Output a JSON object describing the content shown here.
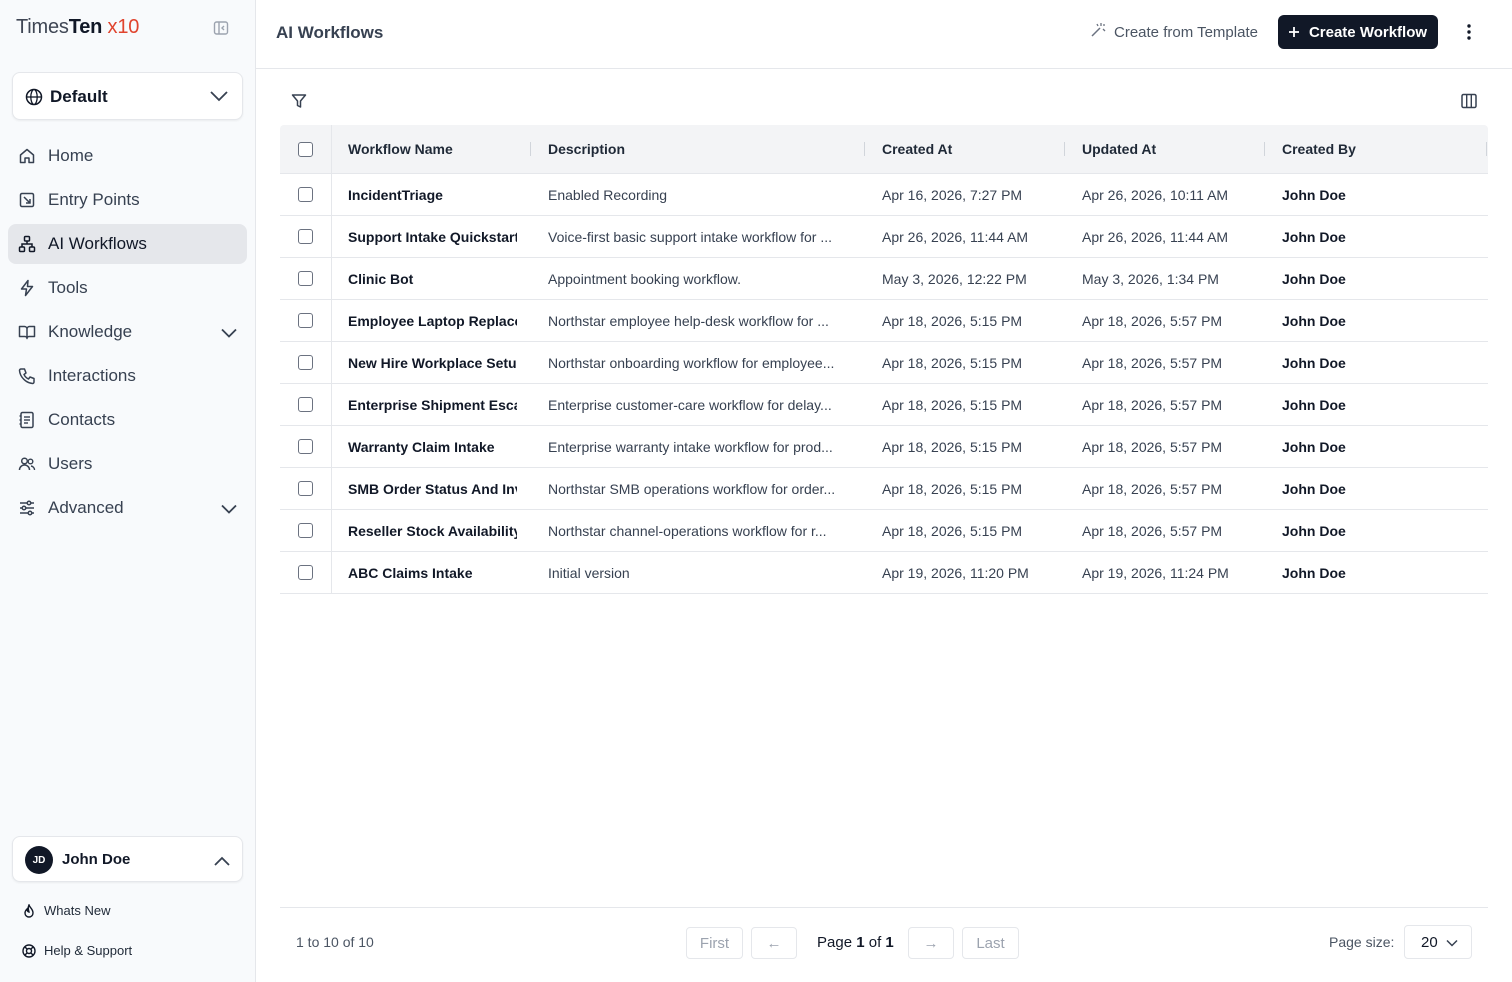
{
  "brand": {
    "part1": "Times",
    "part2": "Ten",
    "part3": " x10"
  },
  "workspace": {
    "label": "Default"
  },
  "nav": [
    {
      "label": "Home",
      "icon": "home-icon",
      "active": false,
      "expandable": false
    },
    {
      "label": "Entry Points",
      "icon": "entry-points-icon",
      "active": false,
      "expandable": false
    },
    {
      "label": "AI Workflows",
      "icon": "workflow-icon",
      "active": true,
      "expandable": false
    },
    {
      "label": "Tools",
      "icon": "bolt-icon",
      "active": false,
      "expandable": false
    },
    {
      "label": "Knowledge",
      "icon": "book-icon",
      "active": false,
      "expandable": true
    },
    {
      "label": "Interactions",
      "icon": "phone-icon",
      "active": false,
      "expandable": false
    },
    {
      "label": "Contacts",
      "icon": "contacts-icon",
      "active": false,
      "expandable": false
    },
    {
      "label": "Users",
      "icon": "users-icon",
      "active": false,
      "expandable": false
    },
    {
      "label": "Advanced",
      "icon": "sliders-icon",
      "active": false,
      "expandable": true
    }
  ],
  "user": {
    "initials": "JD",
    "name": "John Doe"
  },
  "footer": {
    "whats_new": "Whats New",
    "help": "Help & Support"
  },
  "header": {
    "title": "AI Workflows",
    "template_button": "Create from Template",
    "create_button": "Create Workflow"
  },
  "table": {
    "columns": [
      "Workflow Name",
      "Description",
      "Created At",
      "Updated At",
      "Created By"
    ],
    "rows": [
      [
        "IncidentTriage",
        "Enabled Recording",
        "Apr 16, 2026, 7:27 PM",
        "Apr 26, 2026, 10:11 AM",
        "John Doe"
      ],
      [
        "Support Intake Quickstart",
        "Voice-first basic support intake workflow for ...",
        "Apr 26, 2026, 11:44 AM",
        "Apr 26, 2026, 11:44 AM",
        "John Doe"
      ],
      [
        "Clinic Bot",
        "Appointment booking workflow.",
        "May 3, 2026, 12:22 PM",
        "May 3, 2026, 1:34 PM",
        "John Doe"
      ],
      [
        "Employee Laptop Replace",
        "Northstar employee help-desk workflow for ...",
        "Apr 18, 2026, 5:15 PM",
        "Apr 18, 2026, 5:57 PM",
        "John Doe"
      ],
      [
        "New Hire Workplace Setu",
        "Northstar onboarding workflow for employee...",
        "Apr 18, 2026, 5:15 PM",
        "Apr 18, 2026, 5:57 PM",
        "John Doe"
      ],
      [
        "Enterprise Shipment Esca",
        "Enterprise customer-care workflow for delay...",
        "Apr 18, 2026, 5:15 PM",
        "Apr 18, 2026, 5:57 PM",
        "John Doe"
      ],
      [
        "Warranty Claim Intake",
        "Enterprise warranty intake workflow for prod...",
        "Apr 18, 2026, 5:15 PM",
        "Apr 18, 2026, 5:57 PM",
        "John Doe"
      ],
      [
        "SMB Order Status And Inv",
        "Northstar SMB operations workflow for order...",
        "Apr 18, 2026, 5:15 PM",
        "Apr 18, 2026, 5:57 PM",
        "John Doe"
      ],
      [
        "Reseller Stock Availability",
        "Northstar channel-operations workflow for r...",
        "Apr 18, 2026, 5:15 PM",
        "Apr 18, 2026, 5:57 PM",
        "John Doe"
      ],
      [
        "ABC Claims Intake",
        "Initial version",
        "Apr 19, 2026, 11:20 PM",
        "Apr 19, 2026, 11:24 PM",
        "John Doe"
      ]
    ]
  },
  "pagination": {
    "count": "1 to 10 of 10",
    "first": "First",
    "prev": "←",
    "page_word": "Page",
    "current": "1",
    "of_word": "of",
    "total": "1",
    "next": "→",
    "last": "Last",
    "page_size_label": "Page size:",
    "page_size": "20"
  },
  "colors": {
    "accent": "#111827",
    "brand_x10": "#e0442e",
    "active_nav": "#e5e7eb"
  }
}
